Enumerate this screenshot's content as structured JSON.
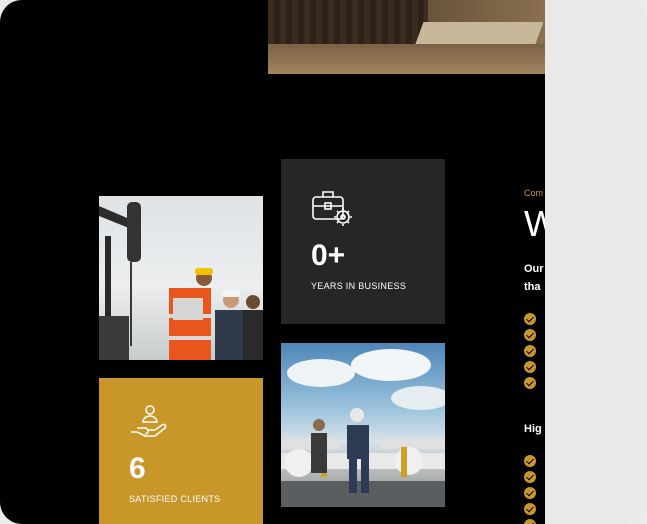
{
  "stats": [
    {
      "number": "0+",
      "label": "YEARS IN BUSINESS",
      "icon": "briefcase-gear-icon"
    },
    {
      "number": "6",
      "label": "SATISFIED CLIENTS",
      "icon": "hand-person-icon"
    }
  ],
  "intro": {
    "eyebrow": "Com",
    "heading": "W",
    "lead_line1": "Our",
    "lead_line2": "tha",
    "subheading": "Hig"
  },
  "colors": {
    "accent": "#c9962a",
    "dark_card": "#262626",
    "background": "#000000"
  }
}
